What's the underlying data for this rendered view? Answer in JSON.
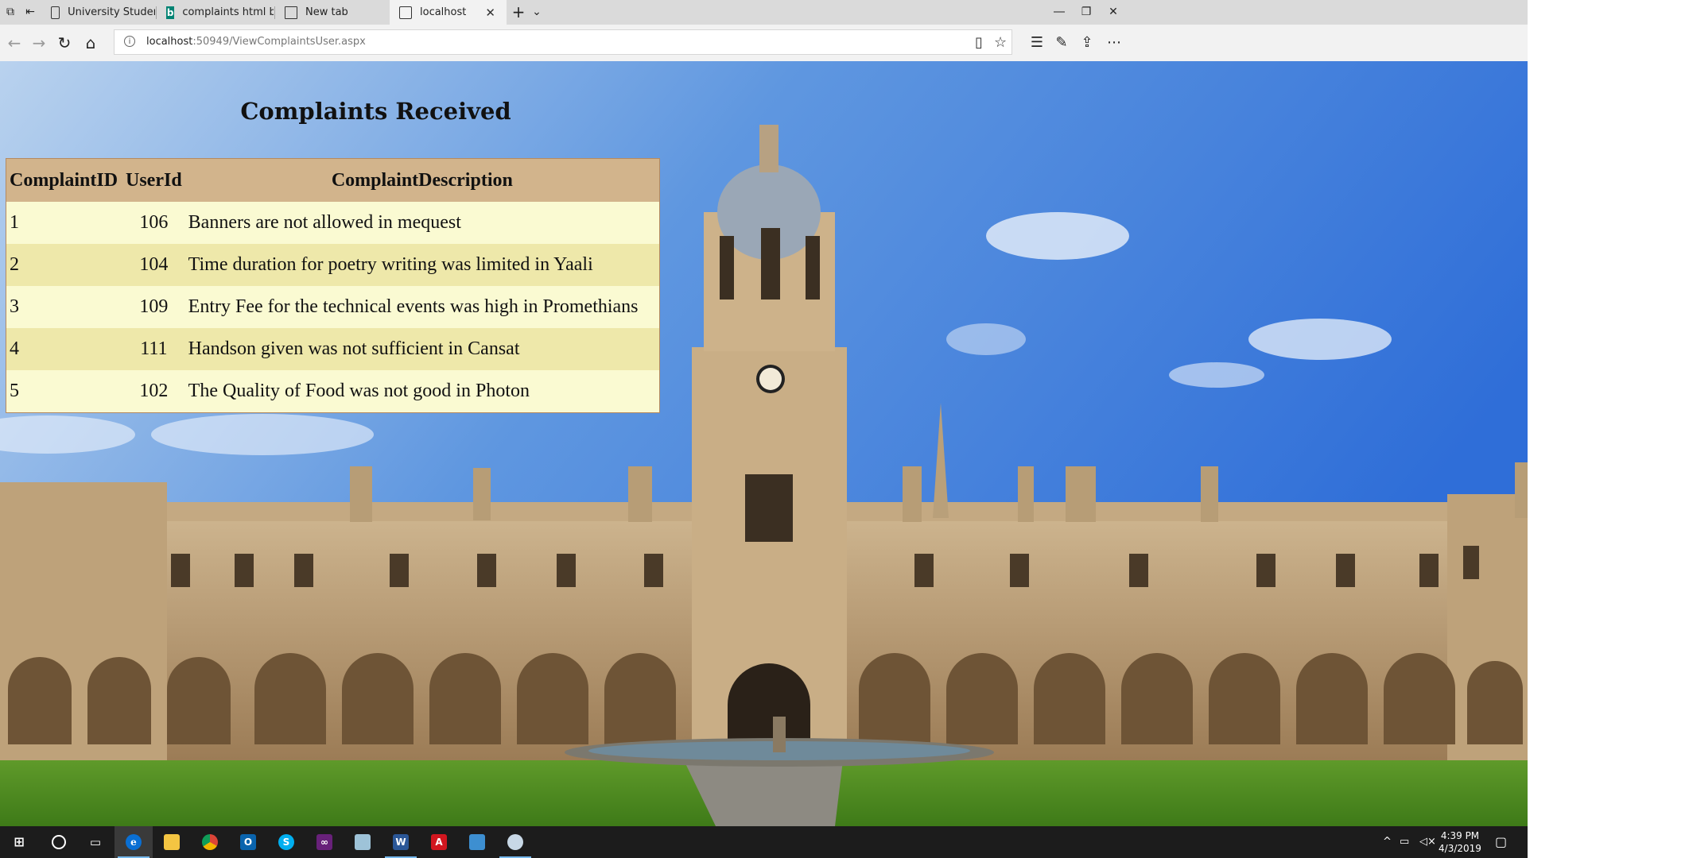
{
  "browser": {
    "tabs": [
      {
        "label": "University Students Union",
        "icon": "page-icon"
      },
      {
        "label": "complaints html backgroun",
        "icon": "bing-icon"
      },
      {
        "label": "New tab",
        "icon": "new-tab-page-icon"
      },
      {
        "label": "localhost",
        "icon": "page-icon",
        "active": true
      }
    ],
    "address": {
      "host": "localhost",
      "rest": ":50949/ViewComplaintsUser.aspx"
    }
  },
  "page": {
    "title": "Complaints Received",
    "table": {
      "headers": [
        "ComplaintID",
        "UserId",
        "ComplaintDescription"
      ],
      "rows": [
        [
          "1",
          "106",
          "Banners are not allowed in mequest"
        ],
        [
          "2",
          "104",
          "Time duration for poetry writing was limited in Yaali"
        ],
        [
          "3",
          "109",
          "Entry Fee for the technical events was high in Promethians"
        ],
        [
          "4",
          "111",
          "Handson given was not sufficient in Cansat"
        ],
        [
          "5",
          "102",
          "The Quality of Food was not good in Photon"
        ]
      ]
    },
    "colors": {
      "header": "#d2b48c",
      "row_odd": "#fafad2",
      "row_even": "#eee8aa"
    }
  },
  "taskbar": {
    "apps": [
      "edge-icon",
      "file-explorer-icon",
      "chrome-icon",
      "outlook-icon",
      "skype-icon",
      "visual-studio-icon",
      "notepad-icon",
      "word-icon",
      "acrobat-icon",
      "remote-desktop-icon",
      "snipping-tool-icon"
    ],
    "time": "4:39 PM",
    "date": "4/3/2019"
  }
}
